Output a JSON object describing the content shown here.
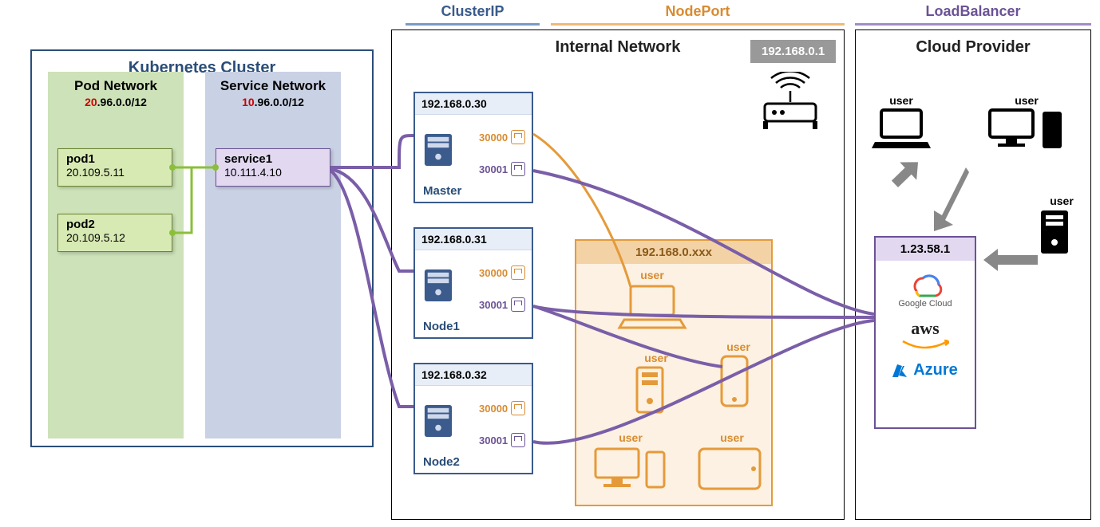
{
  "headers": {
    "clusterip": "ClusterIP",
    "nodeport": "NodePort",
    "loadbalancer": "LoadBalancer"
  },
  "k8s": {
    "title": "Kubernetes Cluster",
    "pod_col_title": "Pod Network",
    "pod_cidr_prefix": "20",
    "pod_cidr_rest": ".96.0.0/12",
    "svc_col_title": "Service Network",
    "svc_cidr_prefix": "10",
    "svc_cidr_rest": ".96.0.0/12",
    "pods": [
      {
        "name": "pod1",
        "ip": "20.109.5.11"
      },
      {
        "name": "pod2",
        "ip": "20.109.5.12"
      }
    ],
    "service": {
      "name": "service1",
      "ip": "10.111.4.10"
    }
  },
  "internal": {
    "title": "Internal Network",
    "router_ip": "192.168.0.1",
    "nodes": [
      {
        "ip": "192.168.0.30",
        "name": "Master",
        "port1": "30000",
        "port2": "30001"
      },
      {
        "ip": "192.168.0.31",
        "name": "Node1",
        "port1": "30000",
        "port2": "30001"
      },
      {
        "ip": "192.168.0.32",
        "name": "Node2",
        "port1": "30000",
        "port2": "30001"
      }
    ],
    "np_zone_title": "192.168.0.xxx",
    "np_users": [
      "user",
      "user",
      "user",
      "user",
      "user"
    ]
  },
  "cloud": {
    "title": "Cloud Provider",
    "lb_ip": "1.23.58.1",
    "providers": {
      "google": "Google Cloud",
      "aws": "aws",
      "azure": "Azure"
    },
    "users": [
      "user",
      "user",
      "user"
    ]
  }
}
